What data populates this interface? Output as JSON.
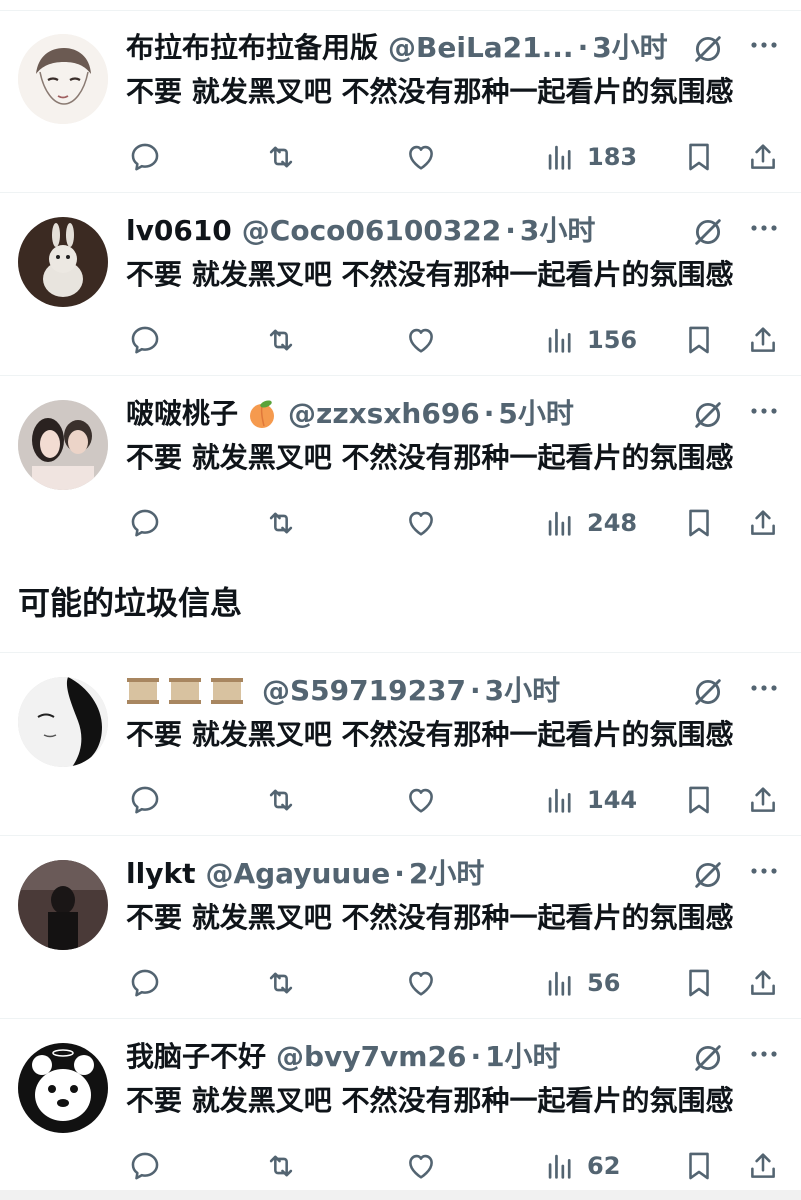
{
  "tweets_top": [
    {
      "name": "布拉布拉布拉备用版",
      "handle": "@BeiLa21...",
      "time": "3小时",
      "text": "不要 就发黑叉吧 不然没有那种一起看片的氛围感",
      "views": "183",
      "avatar": "sketch-face"
    },
    {
      "name": "lv0610",
      "handle": "@Coco06100322",
      "time": "3小时",
      "text": "不要 就发黑叉吧 不然没有那种一起看片的氛围感",
      "views": "156",
      "avatar": "rabbid"
    },
    {
      "name": "啵啵桃子",
      "handle": "@zzxsxh696",
      "time": "5小时",
      "text": "不要 就发黑叉吧 不然没有那种一起看片的氛围感",
      "views": "248",
      "avatar": "couple-photo"
    }
  ],
  "section_title": "可能的垃圾信息",
  "tweets_spam": [
    {
      "name": "",
      "handle": "@S59719237",
      "time": "3小时",
      "text": "不要 就发黑叉吧 不然没有那种一起看片的氛围感",
      "views": "144",
      "avatar": "bw-face"
    },
    {
      "name": "llykt",
      "handle": "@Agayuuue",
      "time": "2小时",
      "text": "不要 就发黑叉吧 不然没有那种一起看片的氛围感",
      "views": "56",
      "avatar": "dark-photo"
    },
    {
      "name": "我脑子不好",
      "handle": "@bvy7vm26",
      "time": "1小时",
      "text": "不要 就发黑叉吧 不然没有那种一起看片的氛围感",
      "views": "62",
      "avatar": "bear-cartoon"
    }
  ],
  "dot": "·",
  "colors": {
    "text": "#0f1419",
    "secondary": "#536471",
    "divider": "#eff3f4"
  }
}
